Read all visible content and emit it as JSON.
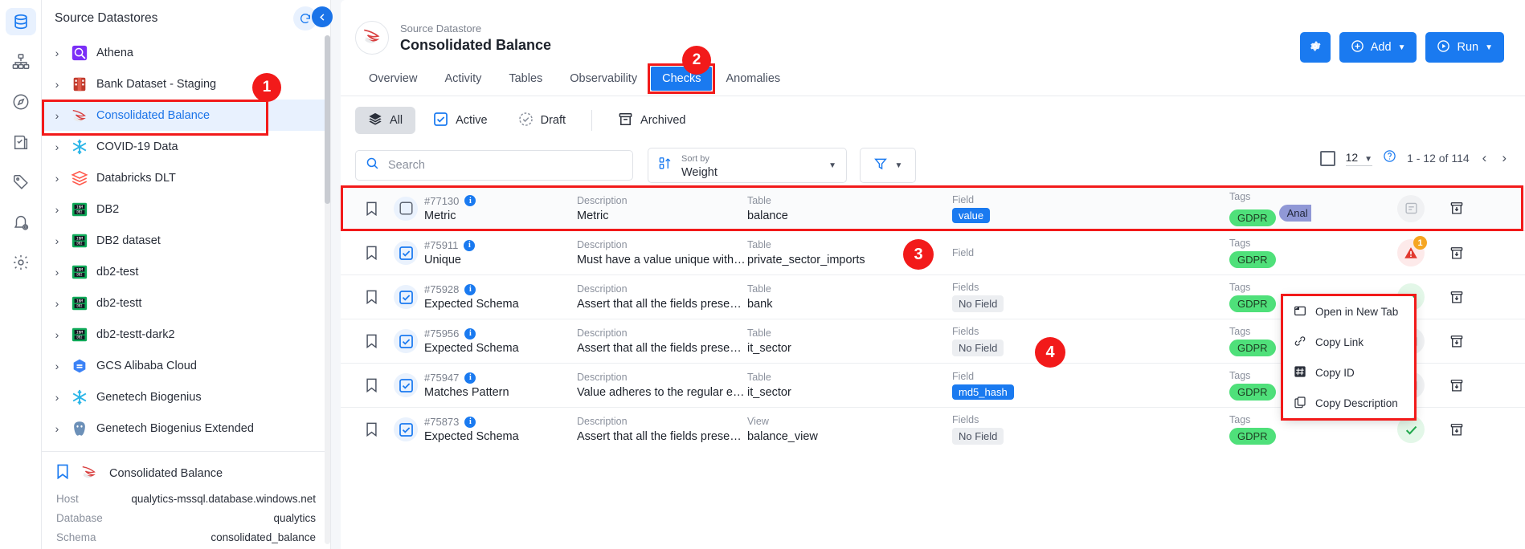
{
  "brand": {
    "accent": "#1a7af0",
    "marker": "#f21a1a",
    "selected_bg": "#e8f1fe"
  },
  "rail": {
    "items": [
      {
        "name": "datastores",
        "icon": "database-icon",
        "active": true
      },
      {
        "name": "lineage",
        "icon": "hierarchy-icon",
        "active": false
      },
      {
        "name": "explore",
        "icon": "compass-icon",
        "active": false
      },
      {
        "name": "tasks",
        "icon": "clipboard-check-icon",
        "active": false
      },
      {
        "name": "tags",
        "icon": "tag-icon",
        "active": false
      },
      {
        "name": "notifications",
        "icon": "bell-gear-icon",
        "active": false
      },
      {
        "name": "settings",
        "icon": "gear-icon",
        "active": false
      }
    ]
  },
  "tree": {
    "title": "Source Datastores",
    "refresh_icon": "refresh-icon",
    "items": [
      {
        "label": "Athena",
        "icon": "athena-icon",
        "selected": false
      },
      {
        "label": "Bank Dataset - Staging",
        "icon": "bank-dataset-icon",
        "selected": false
      },
      {
        "label": "Consolidated Balance",
        "icon": "mssql-icon",
        "selected": true
      },
      {
        "label": "COVID-19 Data",
        "icon": "snowflake-icon",
        "selected": false
      },
      {
        "label": "Databricks DLT",
        "icon": "databricks-icon",
        "selected": false
      },
      {
        "label": "DB2",
        "icon": "db2-icon",
        "selected": false
      },
      {
        "label": "DB2 dataset",
        "icon": "db2-icon",
        "selected": false
      },
      {
        "label": "db2-test",
        "icon": "db2-icon",
        "selected": false
      },
      {
        "label": "db2-testt",
        "icon": "db2-icon",
        "selected": false
      },
      {
        "label": "db2-testt-dark2",
        "icon": "db2-icon",
        "selected": false
      },
      {
        "label": "GCS Alibaba Cloud",
        "icon": "gcs-alibaba-icon",
        "selected": false
      },
      {
        "label": "Genetech Biogenius",
        "icon": "snowflake-icon",
        "selected": false
      },
      {
        "label": "Genetech Biogenius Extended",
        "icon": "postgres-icon",
        "selected": false
      }
    ]
  },
  "datastore_detail": {
    "bookmark_icon": "bookmark-icon",
    "type_icon": "mssql-icon",
    "name": "Consolidated Balance",
    "fields": [
      {
        "key": "Host",
        "value": "qualytics-mssql.database.windows.net"
      },
      {
        "key": "Database",
        "value": "qualytics"
      },
      {
        "key": "Schema",
        "value": "consolidated_balance"
      }
    ]
  },
  "header": {
    "collapse_icon": "chevron-left-icon",
    "avatar_icon": "mssql-icon",
    "kicker": "Source Datastore",
    "title": "Consolidated Balance",
    "settings_icon": "gear-icon",
    "add_label": "Add",
    "add_icon": "plus-circle-icon",
    "run_label": "Run",
    "run_icon": "play-circle-icon",
    "caret_icon": "chevron-down-icon"
  },
  "tabs": [
    {
      "label": "Overview",
      "active": false
    },
    {
      "label": "Activity",
      "active": false
    },
    {
      "label": "Tables",
      "active": false
    },
    {
      "label": "Observability",
      "active": false
    },
    {
      "label": "Checks",
      "active": true
    },
    {
      "label": "Anomalies",
      "active": false
    }
  ],
  "status_chips": [
    {
      "label": "All",
      "icon": "layers-icon",
      "active": true
    },
    {
      "label": "Active",
      "icon": "check-square-icon",
      "active": false
    },
    {
      "label": "Draft",
      "icon": "dashed-check-circle-icon",
      "active": false
    },
    {
      "label": "Archived",
      "icon": "archive-icon",
      "active": false
    }
  ],
  "toolbar": {
    "search_placeholder": "Search",
    "search_value": "",
    "search_icon": "search-icon",
    "sort_label": "Sort by",
    "sort_value": "Weight",
    "sort_icon": "sort-numeric-icon",
    "filter_icon": "funnel-icon",
    "caret_icon": "chevron-down-icon"
  },
  "pagination": {
    "select_all_icon": "checkbox-empty-icon",
    "page_size": "12",
    "help_icon": "help-circle-icon",
    "range": "1 - 12 of 114",
    "prev_icon": "chevron-left-icon",
    "next_icon": "chevron-right-icon"
  },
  "table": {
    "labels": {
      "description": "Description",
      "table": "Table",
      "view": "View",
      "field": "Field",
      "fields": "Fields",
      "tags": "Tags"
    },
    "rows": [
      {
        "id": "#77130",
        "rule": "Metric",
        "desc_label": "Description",
        "desc": "Metric",
        "scope_label": "Table",
        "scope": "balance",
        "field_label": "Field",
        "field": "value",
        "field_style": "blue",
        "tags_label": "Tags",
        "tags": [
          {
            "text": "GDPR",
            "style": "green"
          },
          {
            "text": "Anal",
            "style": "purple"
          }
        ],
        "state": "draft-empty",
        "status": "grey-note",
        "status_badge": "",
        "highlighted": true
      },
      {
        "id": "#75911",
        "rule": "Unique",
        "desc_label": "Description",
        "desc": "Must have a value unique within th...",
        "scope_label": "Table",
        "scope": "private_sector_imports",
        "field_label": "Field",
        "field": "",
        "field_style": "blue",
        "tags_label": "Tags",
        "tags": [
          {
            "text": "GDPR",
            "style": "green"
          }
        ],
        "state": "active",
        "status": "red-alert",
        "status_badge": "1",
        "highlighted": false
      },
      {
        "id": "#75928",
        "rule": "Expected Schema",
        "desc_label": "Description",
        "desc": "Assert that all the fields present in...",
        "scope_label": "Table",
        "scope": "bank",
        "field_label": "Fields",
        "field": "No Field",
        "field_style": "grey",
        "tags_label": "Tags",
        "tags": [
          {
            "text": "GDPR",
            "style": "green"
          }
        ],
        "state": "active",
        "status": "green-check",
        "status_badge": "",
        "highlighted": false
      },
      {
        "id": "#75956",
        "rule": "Expected Schema",
        "desc_label": "Description",
        "desc": "Assert that all the fields present in...",
        "scope_label": "Table",
        "scope": "it_sector",
        "field_label": "Fields",
        "field": "No Field",
        "field_style": "grey",
        "tags_label": "Tags",
        "tags": [
          {
            "text": "GDPR",
            "style": "green"
          }
        ],
        "state": "active",
        "status": "grey-note",
        "status_badge": "",
        "highlighted": false
      },
      {
        "id": "#75947",
        "rule": "Matches Pattern",
        "desc_label": "Description",
        "desc": "Value adheres to the regular expre...",
        "scope_label": "Table",
        "scope": "it_sector",
        "field_label": "Field",
        "field": "md5_hash",
        "field_style": "blue",
        "tags_label": "Tags",
        "tags": [
          {
            "text": "GDPR",
            "style": "green"
          }
        ],
        "state": "active",
        "status": "grey-note",
        "status_badge": "",
        "highlighted": false
      },
      {
        "id": "#75873",
        "rule": "Expected Schema",
        "desc_label": "Description",
        "desc": "Assert that all the fields present in...",
        "scope_label": "View",
        "scope": "balance_view",
        "field_label": "Fields",
        "field": "No Field",
        "field_style": "grey",
        "tags_label": "Tags",
        "tags": [
          {
            "text": "GDPR",
            "style": "green"
          }
        ],
        "state": "active",
        "status": "green-check",
        "status_badge": "",
        "highlighted": false
      }
    ]
  },
  "context_menu": {
    "items": [
      {
        "label": "Open in New Tab",
        "icon": "new-tab-icon"
      },
      {
        "label": "Copy Link",
        "icon": "link-icon"
      },
      {
        "label": "Copy ID",
        "icon": "hash-icon"
      },
      {
        "label": "Copy Description",
        "icon": "copy-icon"
      }
    ]
  },
  "markers": [
    {
      "label": "1"
    },
    {
      "label": "2"
    },
    {
      "label": "3"
    },
    {
      "label": "4"
    }
  ]
}
